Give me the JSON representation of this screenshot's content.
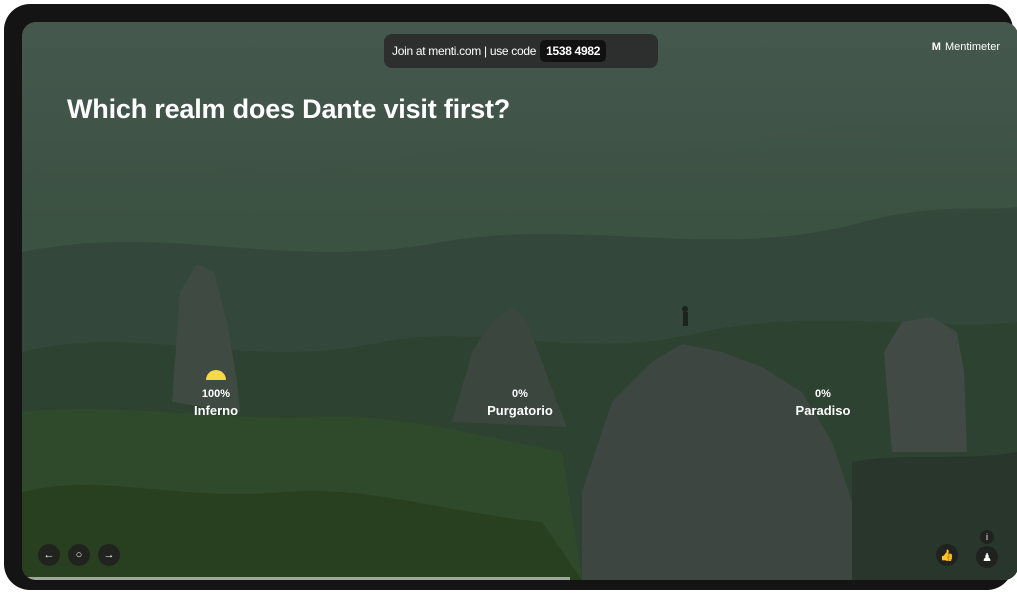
{
  "header": {
    "join_text": "Join at menti.com | use code",
    "code": "1538 4982",
    "brand_name": "Mentimeter"
  },
  "question": "Which realm does Dante visit first?",
  "options": [
    {
      "percent": "100%",
      "label": "Inferno",
      "value": 1.0
    },
    {
      "percent": "0%",
      "label": "Purgatorio",
      "value": 0.0
    },
    {
      "percent": "0%",
      "label": "Paradiso",
      "value": 0.0
    }
  ],
  "colors": {
    "bar": "#f5d94a",
    "pill": "#282828",
    "text": "#ffffff"
  },
  "icons": {
    "back": "arrow-left-icon",
    "hint": "lightbulb-icon",
    "next": "arrow-right-icon",
    "reaction": "thumbs-up-icon",
    "info": "info-icon",
    "participants": "person-icon"
  },
  "presentation_progress": 0.55
}
